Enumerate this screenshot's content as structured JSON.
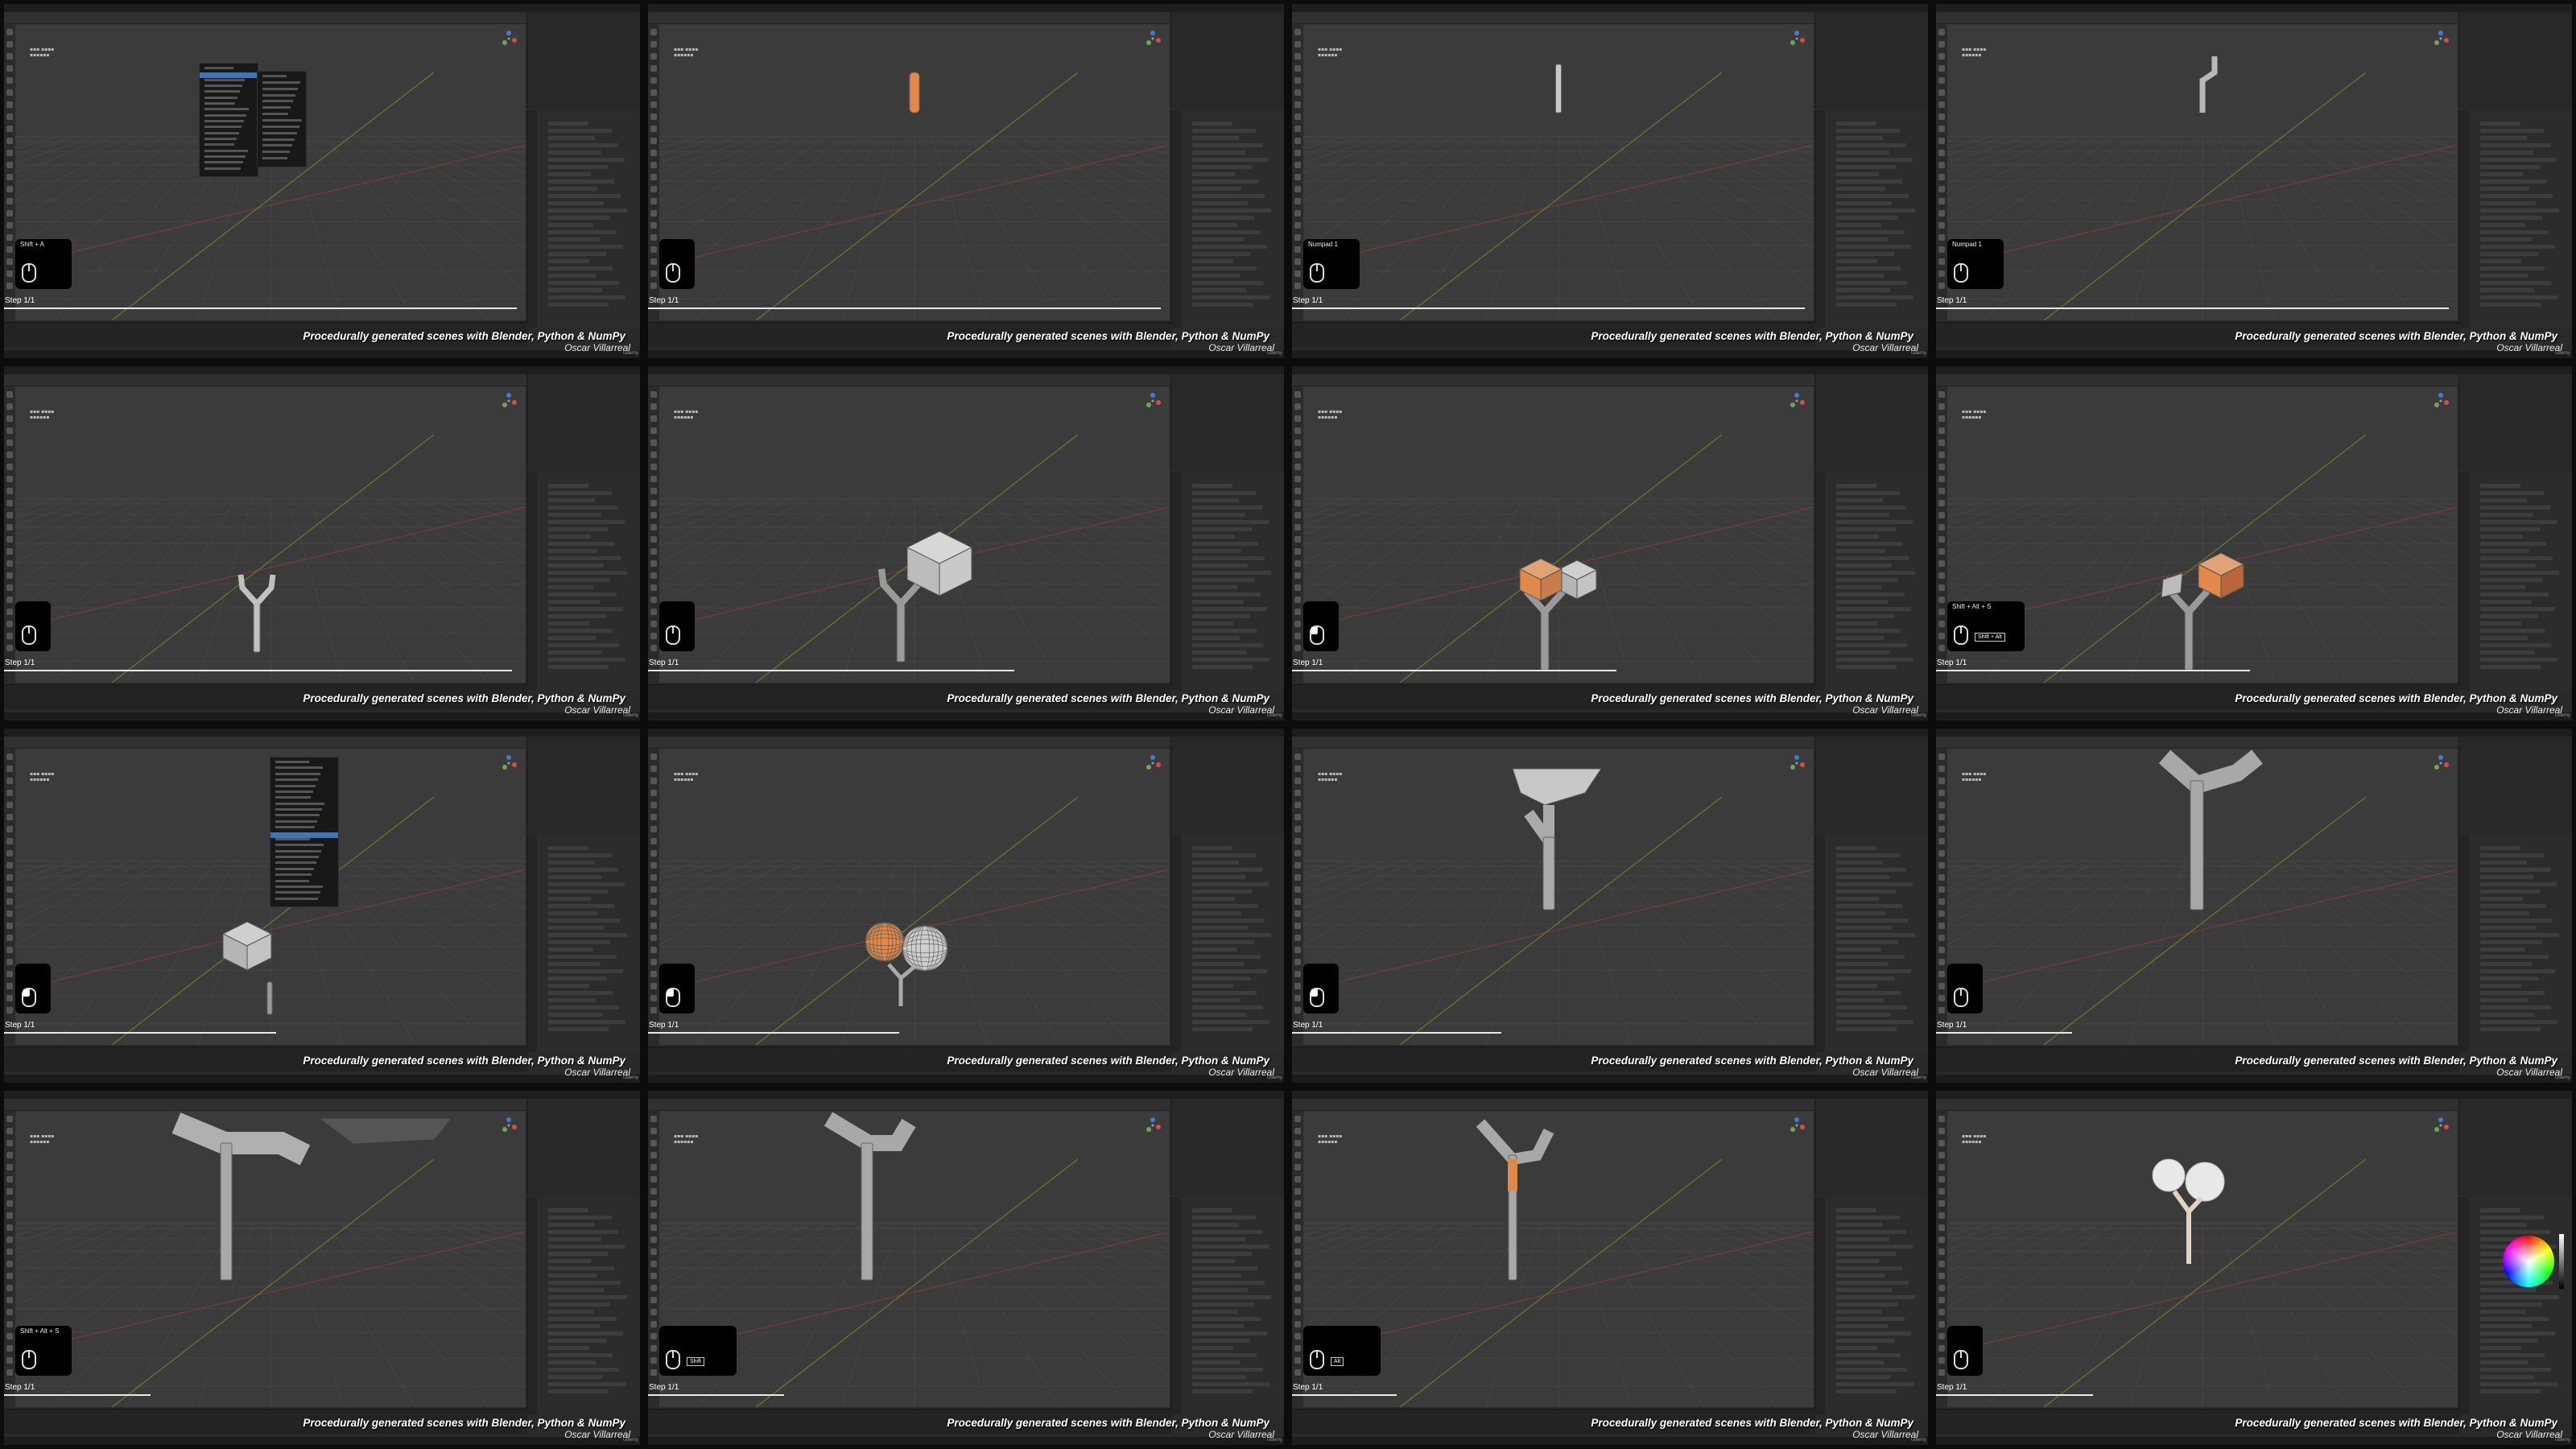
{
  "caption": "Procedurally generated scenes with Blender, Python & NumPy",
  "author": "Oscar Villarreal",
  "author_small": "Udemy",
  "step_label": "Step 1/1",
  "colors": {
    "accent": "#4772b3",
    "selection": "#e0894a",
    "mesh": "#b8b8b8",
    "viewport": "#3b3b3b"
  },
  "frames": [
    {
      "id": 1,
      "scene": "add-menu",
      "keys": "Shift + A",
      "key_box": "",
      "mouse": "none",
      "progress": 0.98
    },
    {
      "id": 2,
      "scene": "cylinder",
      "keys": "",
      "key_box": "",
      "mouse": "none",
      "progress": 0.98
    },
    {
      "id": 3,
      "scene": "thin-stick",
      "keys": "Numpad 1",
      "key_box": "",
      "mouse": "none",
      "progress": 0.98
    },
    {
      "id": 4,
      "scene": "bent-stick",
      "keys": "Numpad 1",
      "key_box": "",
      "mouse": "none",
      "progress": 0.98
    },
    {
      "id": 5,
      "scene": "y-branch",
      "keys": "",
      "key_box": "",
      "mouse": "none",
      "progress": 0.97
    },
    {
      "id": 6,
      "scene": "one-cube",
      "keys": "",
      "key_box": "",
      "mouse": "none",
      "progress": 0.7
    },
    {
      "id": 7,
      "scene": "two-cubes",
      "keys": "",
      "key_box": "",
      "mouse": "lmb",
      "progress": 0.62
    },
    {
      "id": 8,
      "scene": "two-cubes-alt",
      "keys": "Shift + Alt + S",
      "key_box": "Shift + Alt",
      "mouse": "none",
      "progress": 0.6
    },
    {
      "id": 9,
      "scene": "context-menu",
      "keys": "",
      "key_box": "",
      "mouse": "lmb",
      "progress": 0.52
    },
    {
      "id": 10,
      "scene": "two-spheres",
      "keys": "",
      "key_box": "",
      "mouse": "lmb",
      "progress": 0.48
    },
    {
      "id": 11,
      "scene": "closeup-bowl",
      "keys": "",
      "key_box": "",
      "mouse": "lmb",
      "progress": 0.4
    },
    {
      "id": 12,
      "scene": "closeup-y",
      "keys": "",
      "key_box": "",
      "mouse": "none",
      "progress": 0.26
    },
    {
      "id": 13,
      "scene": "closeup-y-wide",
      "keys": "Shift + Alt + S",
      "key_box": "",
      "mouse": "none",
      "progress": 0.28
    },
    {
      "id": 14,
      "scene": "closeup-y-2",
      "keys": "",
      "key_box": "Shift",
      "mouse": "none",
      "progress": 0.26
    },
    {
      "id": 15,
      "scene": "closeup-y-sel",
      "keys": "",
      "key_box": "Alt",
      "mouse": "none",
      "progress": 0.2
    },
    {
      "id": 16,
      "scene": "final-tree",
      "keys": "",
      "key_box": "",
      "mouse": "none",
      "progress": 0.3
    }
  ]
}
